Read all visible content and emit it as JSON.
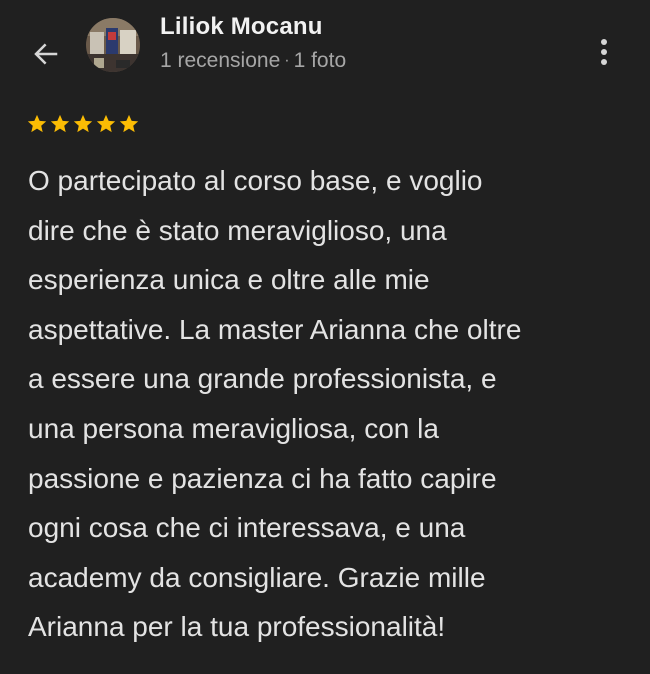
{
  "header": {
    "back_icon": "arrow-left-icon",
    "avatar_description": "profile-photo",
    "user_name": "Liliok Mocanu",
    "reviews_count": "1 recensione",
    "separator": "·",
    "photos_count": "1 foto",
    "menu_icon": "more-vertical-icon"
  },
  "rating": {
    "stars": 5,
    "max_stars": 5,
    "star_color": "#fbbc04"
  },
  "review": {
    "text": "O partecipato al corso base, e voglio\ndire che è stato meraviglioso, una\nesperienza unica e oltre alle mie\naspettative. La master Arianna che oltre\na essere una grande professionista, e\nuna persona meravigliosa, con la\npassione e pazienza ci ha fatto capire\nogni cosa che ci interessava, e una\nacademy da consigliare. Grazie mille\nArianna per la tua professionalità!"
  },
  "colors": {
    "background": "#202020",
    "text_primary": "#e3e3e3",
    "text_secondary": "#a6a6a6"
  }
}
